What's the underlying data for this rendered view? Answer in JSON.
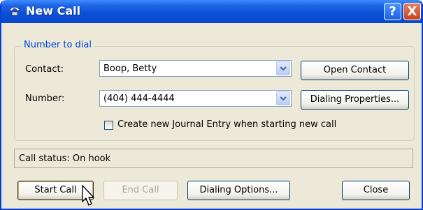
{
  "window": {
    "title": "New Call",
    "help_label": "?",
    "close_label": "X"
  },
  "group": {
    "label": "Number to dial",
    "contact_label": "Contact:",
    "contact_value": "Boop, Betty",
    "number_label": "Number:",
    "number_value": "(404) 444-4444",
    "open_contact_label": "Open Contact",
    "dialing_properties_label": "Dialing Properties...",
    "journal_checkbox_label": "Create new Journal Entry when starting new call",
    "journal_checked": false
  },
  "status": {
    "text": "Call status:  On hook"
  },
  "buttons": {
    "start_call": "Start Call",
    "end_call": "End Call",
    "dialing_options": "Dialing Options...",
    "close": "Close"
  },
  "colors": {
    "titlebar": "#0b4fd8",
    "group_label": "#0046d5",
    "window_bg": "#ece9d8"
  }
}
